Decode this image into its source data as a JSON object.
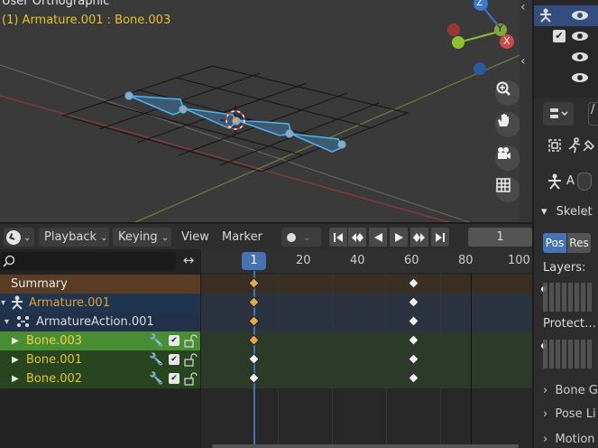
{
  "viewport": {
    "view_name": "User Orthographic",
    "active_object": "(1) Armature.001 : Bone.003",
    "gizmo_axes": [
      "Z",
      "Y",
      "X"
    ]
  },
  "timeline": {
    "editor_icon": "clock-icon",
    "menus": {
      "playback": "Playback",
      "keying": "Keying",
      "view": "View",
      "marker": "Marker"
    },
    "current_frame": "1",
    "ruler_ticks": [
      "1",
      "20",
      "40",
      "60",
      "80",
      "100"
    ],
    "search_placeholder": ""
  },
  "channels": [
    {
      "label": "Summary",
      "kind": "summary"
    },
    {
      "label": "Armature.001",
      "kind": "object"
    },
    {
      "label": "ArmatureAction.001",
      "kind": "action"
    },
    {
      "label": "Bone.003",
      "kind": "bone",
      "active": true
    },
    {
      "label": "Bone.001",
      "kind": "bone"
    },
    {
      "label": "Bone.002",
      "kind": "bone"
    }
  ],
  "keyframes": {
    "frames": [
      1,
      60
    ],
    "rows_selected_first": [
      true,
      true,
      true,
      true,
      false,
      false
    ]
  },
  "properties": {
    "panel_title": "Skelet",
    "pose_button": "Pos",
    "rest_button": "Res",
    "layers_label": "Layers:",
    "protected_label": "Protect",
    "subpanels": [
      "Bone G",
      "Pose Li",
      "Motion"
    ],
    "armature_letter": "A"
  },
  "colors": {
    "accent": "#4772b3",
    "active_text": "#e5c22a",
    "channel_green": "#2a5a26",
    "bone_active_green": "#4a8e34"
  }
}
